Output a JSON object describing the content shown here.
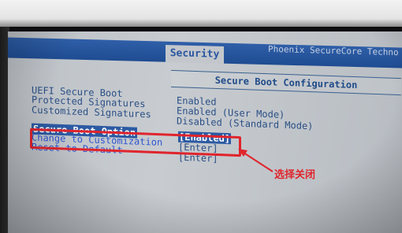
{
  "header": {
    "active_tab": "Security",
    "vendor": "Phoenix SecureCore Techno"
  },
  "section": {
    "title": "Secure Boot Configuration"
  },
  "settings": [
    {
      "label": "UEFI Secure Boot",
      "value": "Enabled"
    },
    {
      "label": "Protected Signatures",
      "value": "Enabled (User Mode)"
    },
    {
      "label": "Customized Signatures",
      "value": "Disabled (Standard Mode)"
    },
    {
      "label": "Secure Boot Option",
      "value": "[Enabled]"
    },
    {
      "label": "Change to Customization",
      "value": "[Enter]"
    },
    {
      "label": "Reset to Default",
      "value": "[Enter]"
    }
  ],
  "annotation": {
    "text": "选择关闭",
    "color": "#e0242c"
  },
  "colors": {
    "header_blue": "#2f5fa8",
    "text_blue": "#2b4f85",
    "highlight_red": "#e0242c"
  }
}
